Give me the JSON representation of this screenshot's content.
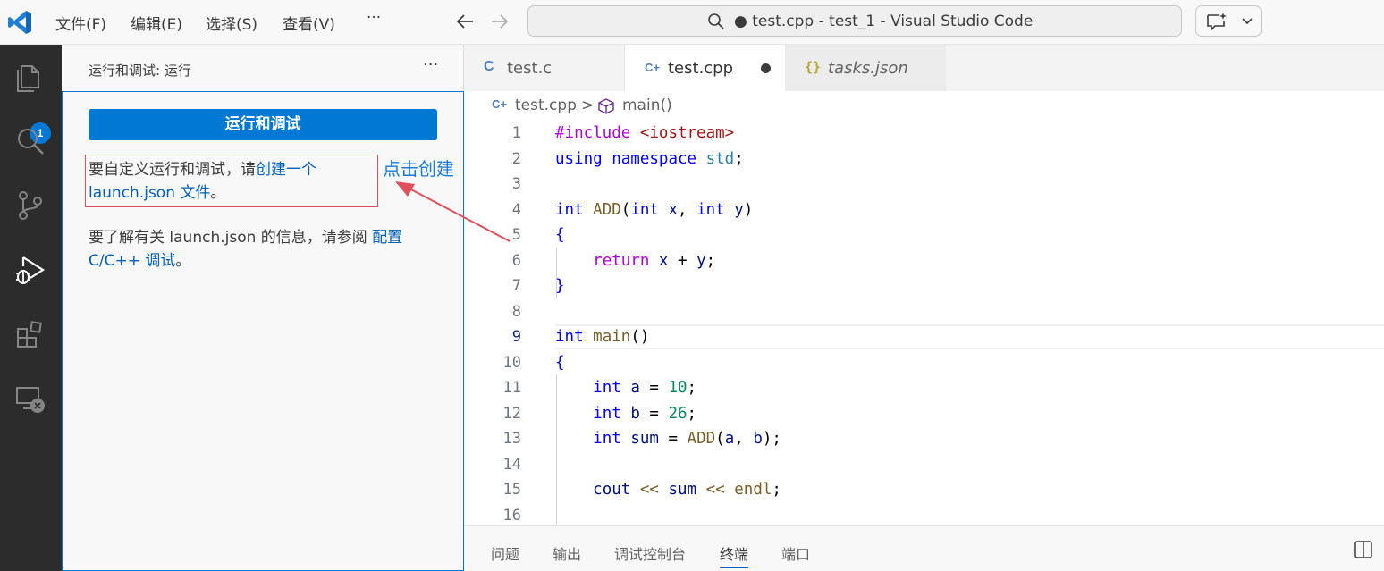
{
  "titlebar": {
    "menu": [
      "文件(F)",
      "编辑(E)",
      "选择(S)",
      "查看(V)",
      "···"
    ],
    "search_text": "● test.cpp - test_1 - Visual Studio Code"
  },
  "activitybar": {
    "icons": [
      "explorer-icon",
      "search-icon",
      "source-control-icon",
      "run-debug-icon",
      "extensions-icon",
      "remote-explorer-icon"
    ],
    "explorer_badge": "1"
  },
  "sidebar": {
    "title": "运行和调试: 运行",
    "more": "···",
    "run_button": "运行和调试",
    "para1_text": "要自定义运行和调试，请",
    "para1_link1": "创建一个",
    "para1_link2": "launch.json 文件",
    "para1_end": "。",
    "para2_text": "要了解有关 launch.json 的信息，请参阅 ",
    "para2_link1": "配置",
    "para2_link2": "C/C++ 调试",
    "para2_end": "。"
  },
  "annotation": {
    "text": "点击创建",
    "color": "#1a7ad6",
    "box_color": "#e0505a"
  },
  "tabs": [
    {
      "icon": "C",
      "label": "test.c",
      "active": false
    },
    {
      "icon": "C+",
      "label": "test.cpp",
      "active": true,
      "dirty": true
    },
    {
      "icon": "{}",
      "label": "tasks.json",
      "active": false
    }
  ],
  "breadcrumb": {
    "file": "test.cpp",
    "separator": ">",
    "symbol": "main()"
  },
  "editor": {
    "line_numbers": [
      "1",
      "2",
      "3",
      "4",
      "5",
      "6",
      "7",
      "8",
      "9",
      "10",
      "11",
      "12",
      "13",
      "14",
      "15",
      "16"
    ],
    "active_line": "9"
  },
  "panel": {
    "tabs": [
      "问题",
      "输出",
      "调试控制台",
      "终端",
      "端口"
    ],
    "active": "终端"
  },
  "colors": {
    "accent": "#0078d4",
    "activitybar": "#2c2c2c",
    "keyword": "#0000ff",
    "preprocessor": "#af00db",
    "string": "#a31515",
    "function": "#795e26",
    "number": "#098658"
  }
}
